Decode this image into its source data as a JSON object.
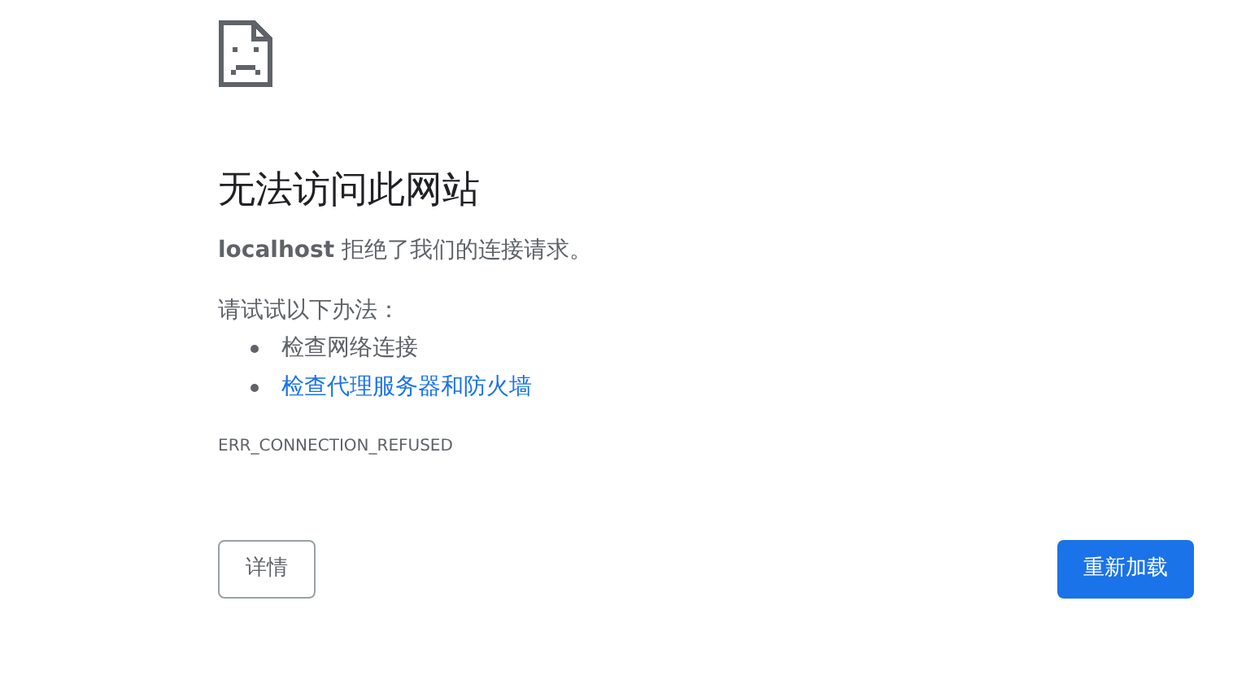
{
  "title": "无法访问此网站",
  "message": "**localhost** 拒绝了我们的连接请求。",
  "suggestions_heading": "请试试以下办法：",
  "suggestions": [
    {
      "kind": "text",
      "label": "检查网络连接"
    },
    {
      "kind": "link",
      "label": "检查代理服务器和防火墙"
    }
  ],
  "error_code": "ERR_CONNECTION_REFUSED",
  "buttons": [
    {
      "kind": "secondary",
      "label": "详情"
    },
    {
      "kind": "primary",
      "label": "重新加载"
    }
  ]
}
